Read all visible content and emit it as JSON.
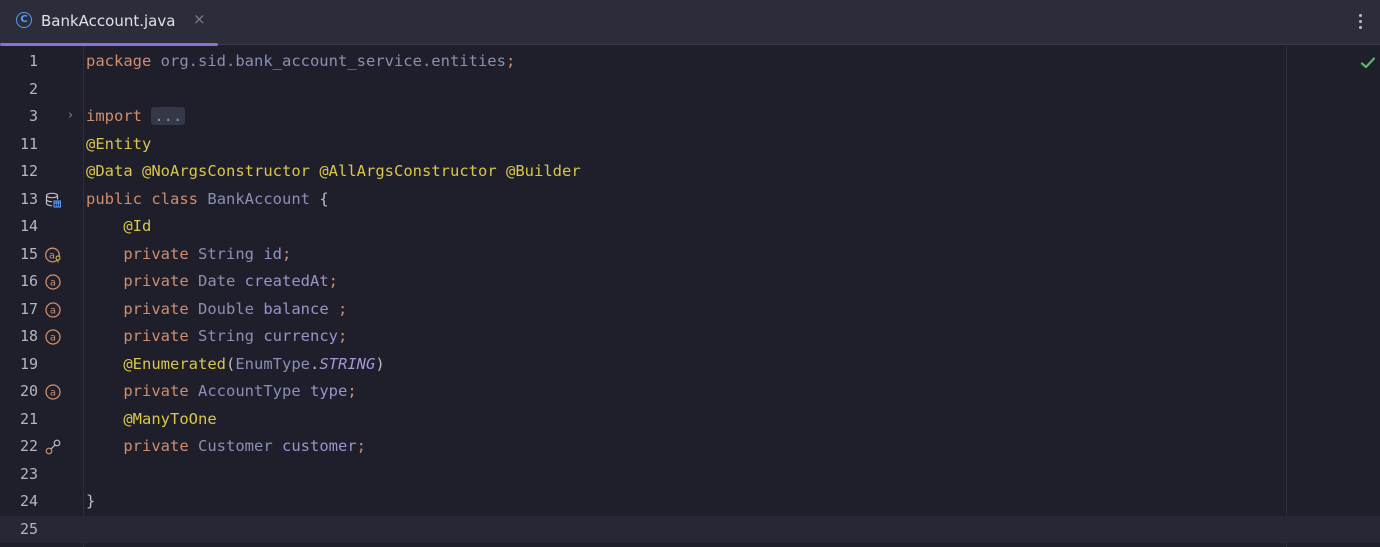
{
  "tab": {
    "filename": "BankAccount.java",
    "icon": "class-icon",
    "close": "×"
  },
  "colors": {
    "keyword": "#cf8e6d",
    "annotation": "#d9c64b",
    "type": "#8a8fb3",
    "accent": "#8e6fd6",
    "check": "#5fb865"
  },
  "editor": {
    "inspection_status": "check-icon",
    "current_line": 25,
    "lines": [
      {
        "n": "1",
        "gutter": "",
        "segs": [
          [
            "kw",
            "package"
          ],
          [
            "br",
            " "
          ],
          [
            "pk",
            "org.sid.bank_account_service.entities"
          ],
          [
            "kw",
            ";"
          ]
        ]
      },
      {
        "n": "2",
        "gutter": "",
        "segs": []
      },
      {
        "n": "3",
        "gutter": "fold",
        "segs": [
          [
            "kw",
            "import"
          ],
          [
            "br",
            " "
          ],
          [
            "ellipsis",
            "..."
          ]
        ]
      },
      {
        "n": "11",
        "gutter": "",
        "segs": [
          [
            "an",
            "@Entity"
          ]
        ]
      },
      {
        "n": "12",
        "gutter": "",
        "segs": [
          [
            "an",
            "@Data"
          ],
          [
            "br",
            " "
          ],
          [
            "an",
            "@NoArgsConstructor"
          ],
          [
            "br",
            " "
          ],
          [
            "an",
            "@AllArgsConstructor"
          ],
          [
            "br",
            " "
          ],
          [
            "an",
            "@Builder"
          ]
        ]
      },
      {
        "n": "13",
        "gutter": "database-icon",
        "segs": [
          [
            "kw",
            "public"
          ],
          [
            "br",
            " "
          ],
          [
            "kw",
            "class"
          ],
          [
            "br",
            " "
          ],
          [
            "ty",
            "BankAccount"
          ],
          [
            "br",
            " {"
          ]
        ]
      },
      {
        "n": "14",
        "gutter": "",
        "segs": [
          [
            "br",
            "    "
          ],
          [
            "an",
            "@Id"
          ]
        ]
      },
      {
        "n": "15",
        "gutter": "id-column-icon",
        "segs": [
          [
            "br",
            "    "
          ],
          [
            "kw",
            "private"
          ],
          [
            "br",
            " "
          ],
          [
            "ty",
            "String"
          ],
          [
            "br",
            " "
          ],
          [
            "fd",
            "id"
          ],
          [
            "kw",
            ";"
          ]
        ]
      },
      {
        "n": "16",
        "gutter": "column-icon",
        "segs": [
          [
            "br",
            "    "
          ],
          [
            "kw",
            "private"
          ],
          [
            "br",
            " "
          ],
          [
            "ty",
            "Date"
          ],
          [
            "br",
            " "
          ],
          [
            "fd",
            "createdAt"
          ],
          [
            "kw",
            ";"
          ]
        ]
      },
      {
        "n": "17",
        "gutter": "column-icon",
        "segs": [
          [
            "br",
            "    "
          ],
          [
            "kw",
            "private"
          ],
          [
            "br",
            " "
          ],
          [
            "ty",
            "Double"
          ],
          [
            "br",
            " "
          ],
          [
            "fd",
            "balance"
          ],
          [
            "br",
            " "
          ],
          [
            "kw",
            ";"
          ]
        ]
      },
      {
        "n": "18",
        "gutter": "column-icon",
        "segs": [
          [
            "br",
            "    "
          ],
          [
            "kw",
            "private"
          ],
          [
            "br",
            " "
          ],
          [
            "ty",
            "String"
          ],
          [
            "br",
            " "
          ],
          [
            "fd",
            "currency"
          ],
          [
            "kw",
            ";"
          ]
        ]
      },
      {
        "n": "19",
        "gutter": "",
        "segs": [
          [
            "br",
            "    "
          ],
          [
            "an",
            "@Enumerated"
          ],
          [
            "br",
            "("
          ],
          [
            "ty",
            "EnumType"
          ],
          [
            "br",
            "."
          ],
          [
            "st",
            "STRING"
          ],
          [
            "br",
            ")"
          ]
        ]
      },
      {
        "n": "20",
        "gutter": "column-icon",
        "segs": [
          [
            "br",
            "    "
          ],
          [
            "kw",
            "private"
          ],
          [
            "br",
            " "
          ],
          [
            "ty",
            "AccountType"
          ],
          [
            "br",
            " "
          ],
          [
            "fd",
            "type"
          ],
          [
            "kw",
            ";"
          ]
        ]
      },
      {
        "n": "21",
        "gutter": "",
        "segs": [
          [
            "br",
            "    "
          ],
          [
            "an",
            "@ManyToOne"
          ]
        ]
      },
      {
        "n": "22",
        "gutter": "relation-icon",
        "segs": [
          [
            "br",
            "    "
          ],
          [
            "kw",
            "private"
          ],
          [
            "br",
            " "
          ],
          [
            "ty",
            "Customer"
          ],
          [
            "br",
            " "
          ],
          [
            "fd",
            "customer"
          ],
          [
            "kw",
            ";"
          ]
        ]
      },
      {
        "n": "23",
        "gutter": "",
        "segs": []
      },
      {
        "n": "24",
        "gutter": "",
        "segs": [
          [
            "br",
            "}"
          ]
        ]
      },
      {
        "n": "25",
        "gutter": "",
        "segs": []
      }
    ]
  }
}
